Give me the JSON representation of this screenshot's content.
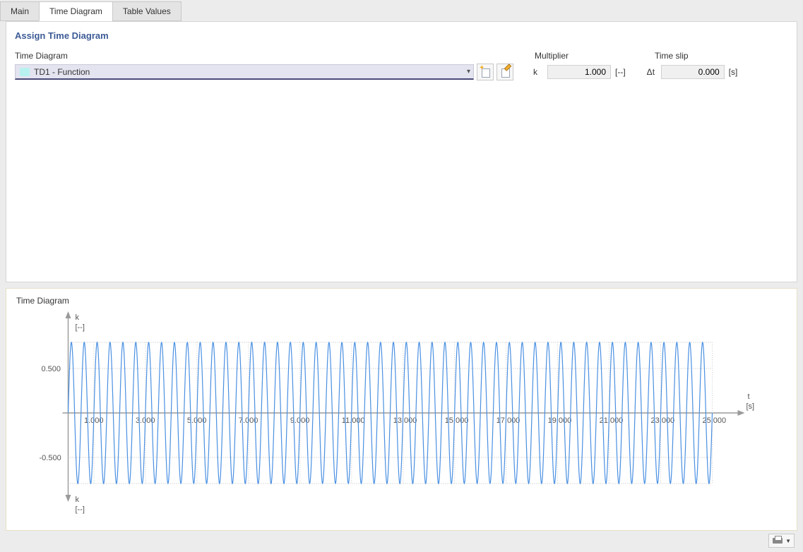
{
  "tabs": {
    "main": "Main",
    "diagram": "Time Diagram",
    "table": "Table Values"
  },
  "section": {
    "title": "Assign Time Diagram"
  },
  "labels": {
    "time_diagram": "Time Diagram",
    "multiplier": "Multiplier",
    "time_slip": "Time slip"
  },
  "dropdown": {
    "selected": "TD1 - Function"
  },
  "multiplier": {
    "symbol": "k",
    "value": "1.000",
    "unit": "[--]"
  },
  "timeslip": {
    "symbol": "Δt",
    "value": "0.000",
    "unit": "[s]"
  },
  "chart": {
    "title": "Time Diagram",
    "y_top_label": "k",
    "y_top_unit": "[--]",
    "y_bot_label": "k",
    "y_bot_unit": "[--]",
    "x_label": "t",
    "x_unit": "[s]",
    "y_ticks": [
      "0.500",
      "-0.500"
    ],
    "x_ticks": [
      "1.000",
      "3.000",
      "5.000",
      "7.000",
      "9.000",
      "11.000",
      "13.000",
      "15.000",
      "17.000",
      "19.000",
      "21.000",
      "23.000",
      "25.000"
    ]
  },
  "chart_data": {
    "type": "line",
    "title": "Time Diagram",
    "xlabel": "t [s]",
    "ylabel": "k [--]",
    "xlim": [
      0,
      25
    ],
    "ylim": [
      -0.8,
      0.8
    ],
    "function": "0.8 * sin(2*pi*t / 0.5)",
    "amplitude": 0.8,
    "period": 0.5,
    "x_tick_values": [
      1,
      3,
      5,
      7,
      9,
      11,
      13,
      15,
      17,
      19,
      21,
      23,
      25
    ],
    "y_tick_values": [
      -0.5,
      0.5
    ]
  }
}
